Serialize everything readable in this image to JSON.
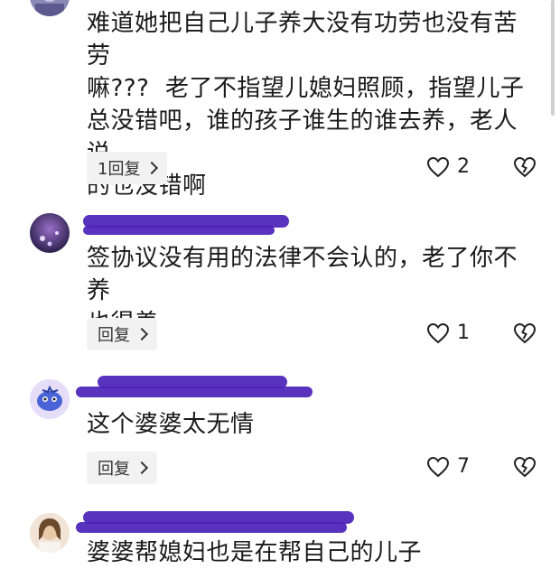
{
  "comments": [
    {
      "text": "难道她把自己儿子养大没有功劳也没有苦劳\n嘛???  老了不指望儿媳妇照顾，指望儿子\n总没错吧，谁的孩子谁生的谁去养，老人说\n的也没错啊",
      "reply_label": "1回复",
      "like_count": "2"
    },
    {
      "text": "签协议没有用的法律不会认的，老了你不养\n也得养",
      "reply_label": "回复",
      "like_count": "1"
    },
    {
      "text": "这个婆婆太无情",
      "reply_label": "回复",
      "like_count": "7"
    },
    {
      "text": "婆婆帮媳妇也是在帮自己的儿子"
    }
  ],
  "icons": {
    "like": "heart-outline-icon",
    "dislike": "broken-heart-icon",
    "chevron": "chevron-right-icon"
  },
  "colors": {
    "redaction": "#4a22b8",
    "reply_bg": "#f2f2f2"
  }
}
